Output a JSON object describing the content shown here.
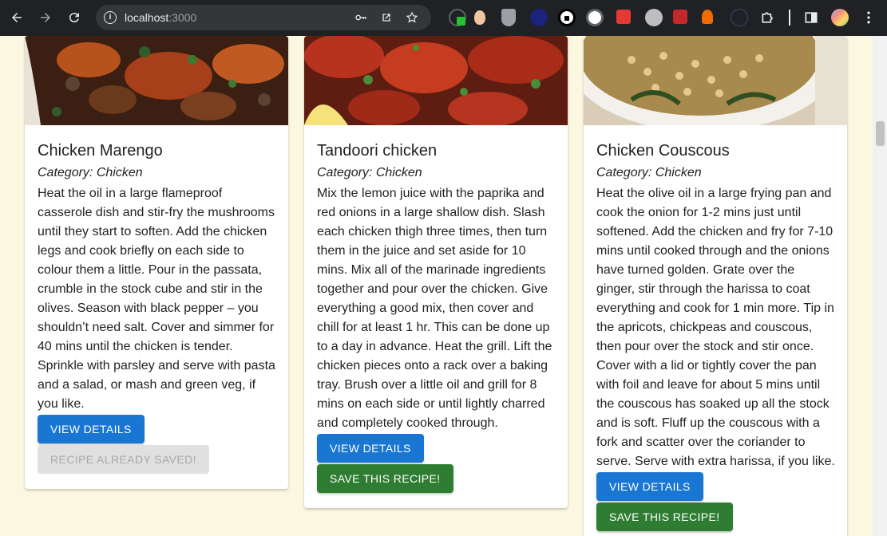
{
  "browser": {
    "url_host": "localhost",
    "url_port": ":3000"
  },
  "cards": [
    {
      "title": "Chicken Marengo",
      "category": "Category: Chicken",
      "description": "Heat the oil in a large flameproof casserole dish and stir-fry the mushrooms until they start to soften. Add the chicken legs and cook briefly on each side to colour them a little. Pour in the passata, crumble in the stock cube and stir in the olives. Season with black pepper – you shouldn’t need salt. Cover and simmer for 40 mins until the chicken is tender. Sprinkle with parsley and serve with pasta and a salad, or mash and green veg, if you like.",
      "details_label": "VIEW DETAILS",
      "save_label": "RECIPE ALREADY SAVED!"
    },
    {
      "title": "Tandoori chicken",
      "category": "Category: Chicken",
      "description": "Mix the lemon juice with the paprika and red onions in a large shallow dish. Slash each chicken thigh three times, then turn them in the juice and set aside for 10 mins. Mix all of the marinade ingredients together and pour over the chicken. Give everything a good mix, then cover and chill for at least 1 hr. This can be done up to a day in advance. Heat the grill. Lift the chicken pieces onto a rack over a baking tray. Brush over a little oil and grill for 8 mins on each side or until lightly charred and completely cooked through.",
      "details_label": "VIEW DETAILS",
      "save_label": "SAVE THIS RECIPE!"
    },
    {
      "title": "Chicken Couscous",
      "category": "Category: Chicken",
      "description": "Heat the olive oil in a large frying pan and cook the onion for 1-2 mins just until softened. Add the chicken and fry for 7-10 mins until cooked through and the onions have turned golden. Grate over the ginger, stir through the harissa to coat everything and cook for 1 min more. Tip in the apricots, chickpeas and couscous, then pour over the stock and stir once. Cover with a lid or tightly cover the pan with foil and leave for about 5 mins until the couscous has soaked up all the stock and is soft. Fluff up the couscous with a fork and scatter over the coriander to serve. Serve with extra harissa, if you like.",
      "details_label": "VIEW DETAILS",
      "save_label": "SAVE THIS RECIPE!"
    }
  ],
  "colors": {
    "primary": "#1976d2",
    "save": "#2e7d32",
    "saved_disabled": "#e0e0e0",
    "page_background": "#fbf7e0"
  }
}
